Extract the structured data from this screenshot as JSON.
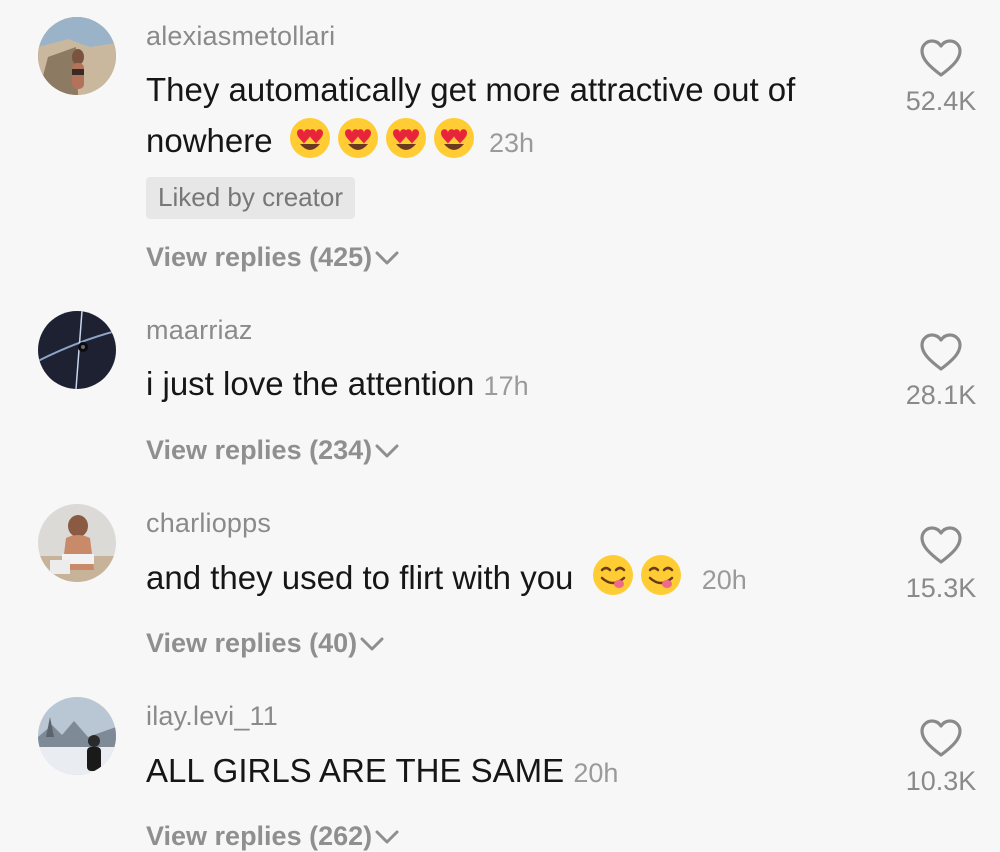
{
  "comments": [
    {
      "username": "alexiasmetollari",
      "text_lines": [
        "They automatically get more attractive out of",
        "nowhere"
      ],
      "emojis": [
        "heart-eyes-emoji",
        "heart-eyes-emoji",
        "heart-eyes-emoji",
        "heart-eyes-emoji"
      ],
      "time": "23h",
      "badge": "Liked by creator",
      "replies": "View replies (425)",
      "likes": "52.4K"
    },
    {
      "username": "maarriaz",
      "text": "i just love the attention",
      "time": "17h",
      "replies": "View replies (234)",
      "likes": "28.1K"
    },
    {
      "username": "charliopps",
      "text": "and they used to flirt with you",
      "emojis": [
        "yum-emoji",
        "yum-emoji"
      ],
      "time": "20h",
      "replies": "View replies (40)",
      "likes": "15.3K"
    },
    {
      "username": "ilay.levi_11",
      "text": "ALL GIRLS ARE THE SAME",
      "time": "20h",
      "replies": "View replies (262)",
      "likes": "10.3K"
    }
  ],
  "icons": {
    "like": "heart-outline-icon",
    "expand": "chevron-down-icon"
  },
  "colors": {
    "background": "#f7f7f7",
    "username": "#8a8a8a",
    "text": "#161616",
    "meta": "#9a9a9a"
  }
}
